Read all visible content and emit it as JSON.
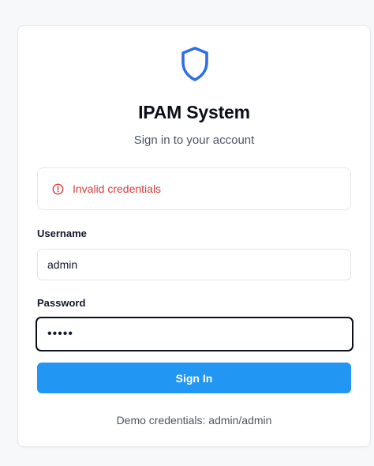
{
  "login": {
    "logo_icon": "shield-icon",
    "title": "IPAM System",
    "subtitle": "Sign in to your account",
    "error": {
      "icon": "alert-circle-icon",
      "message": "Invalid credentials",
      "color": "#dc3b3b"
    },
    "username": {
      "label": "Username",
      "value": "admin"
    },
    "password": {
      "label": "Password",
      "value": "•••••"
    },
    "submit_label": "Sign In",
    "demo_text": "Demo credentials: admin/admin"
  },
  "colors": {
    "accent": "#2196f3",
    "shield": "#2f6fe4",
    "error": "#dc3b3b"
  }
}
